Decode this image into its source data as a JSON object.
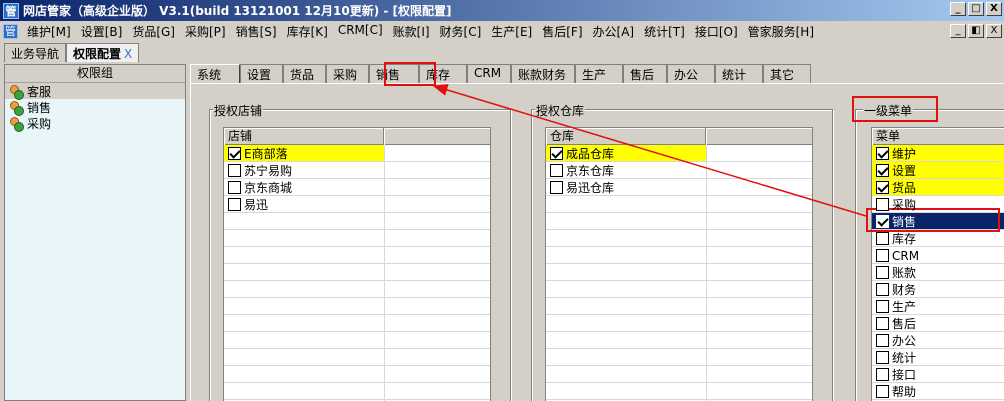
{
  "window": {
    "title": "网店管家（高级企业版） V3.1(build 13121001 12月10更新) - [权限配置]",
    "icon": "app-icon",
    "controls": [
      "_",
      "□",
      "X"
    ],
    "mdi_controls": [
      "_",
      "◧",
      "X"
    ]
  },
  "menu": [
    "维护[M]",
    "设置[B]",
    "货品[G]",
    "采购[P]",
    "销售[S]",
    "库存[K]",
    "CRM[C]",
    "账款[I]",
    "财务[C]",
    "生产[E]",
    "售后[F]",
    "办公[A]",
    "统计[T]",
    "接口[O]",
    "管家服务[H]"
  ],
  "doc_tabs": [
    {
      "label": "业务导航",
      "active": false
    },
    {
      "label": "权限配置",
      "active": true,
      "close": "X"
    }
  ],
  "left_panel": {
    "header": "权限组",
    "items": [
      {
        "label": "客服",
        "icon": "user-group-icon",
        "selected": true
      },
      {
        "label": "销售",
        "icon": "user-group-icon",
        "selected": false
      },
      {
        "label": "采购",
        "icon": "user-group-icon",
        "selected": false
      }
    ]
  },
  "tabs": [
    {
      "label": "系统",
      "active": true
    },
    {
      "label": "设置"
    },
    {
      "label": "货品"
    },
    {
      "label": "采购"
    },
    {
      "label": "销售",
      "highlighted": true
    },
    {
      "label": "库存"
    },
    {
      "label": "CRM"
    },
    {
      "label": "账款财务"
    },
    {
      "label": "生产"
    },
    {
      "label": "售后"
    },
    {
      "label": "办公"
    },
    {
      "label": "统计"
    },
    {
      "label": "其它"
    }
  ],
  "shops": {
    "title": "授权店铺",
    "column": "店铺",
    "rows": [
      {
        "label": "E商部落",
        "checked": true,
        "highlight": true
      },
      {
        "label": "苏宁易购",
        "checked": false
      },
      {
        "label": "京东商城",
        "checked": false
      },
      {
        "label": "易迅",
        "checked": false
      }
    ]
  },
  "warehouses": {
    "title": "授权仓库",
    "column": "仓库",
    "rows": [
      {
        "label": "成品仓库",
        "checked": true,
        "highlight": true
      },
      {
        "label": "京东仓库",
        "checked": false
      },
      {
        "label": "易迅仓库",
        "checked": false
      }
    ]
  },
  "menus": {
    "title": "一级菜单",
    "column": "菜单",
    "rows": [
      {
        "label": "维护",
        "checked": true,
        "highlight": true
      },
      {
        "label": "设置",
        "checked": true,
        "highlight": true
      },
      {
        "label": "货品",
        "checked": true,
        "highlight": true
      },
      {
        "label": "采购",
        "checked": false
      },
      {
        "label": "销售",
        "checked": true,
        "selected": true
      },
      {
        "label": "库存",
        "checked": false
      },
      {
        "label": "CRM",
        "checked": false
      },
      {
        "label": "账款",
        "checked": false
      },
      {
        "label": "财务",
        "checked": false
      },
      {
        "label": "生产",
        "checked": false
      },
      {
        "label": "售后",
        "checked": false
      },
      {
        "label": "办公",
        "checked": false
      },
      {
        "label": "统计",
        "checked": false
      },
      {
        "label": "接口",
        "checked": false
      },
      {
        "label": "帮助",
        "checked": false
      }
    ]
  },
  "colors": {
    "highlight": "#ffff00",
    "selection": "#0a246a",
    "annotation": "#e01010",
    "panel": "#e8f6fa"
  }
}
